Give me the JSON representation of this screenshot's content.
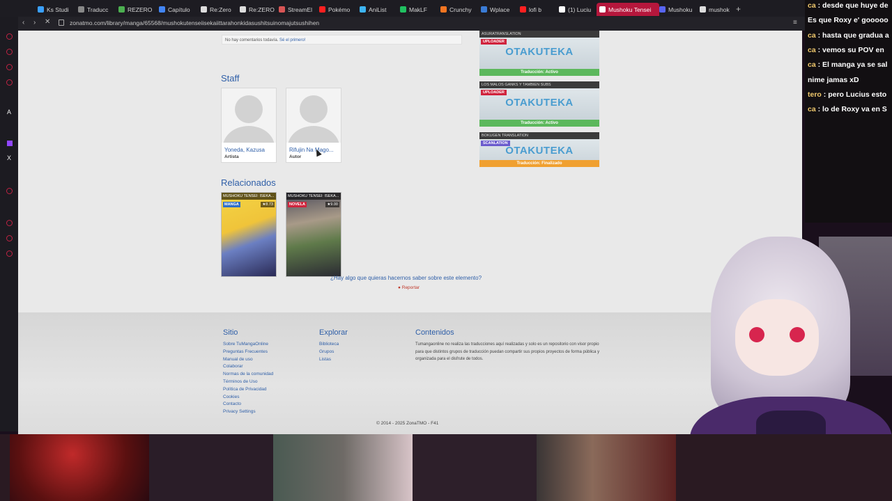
{
  "browser": {
    "tabs": [
      {
        "label": "Ks Studi",
        "color": "#3aa0ff"
      },
      {
        "label": "Traducc",
        "color": "#888888"
      },
      {
        "label": "REZERO",
        "color": "#4caf50"
      },
      {
        "label": "Capítulo",
        "color": "#4285f4"
      },
      {
        "label": "Re:Zero",
        "color": "#dddddd"
      },
      {
        "label": "Re:ZERO",
        "color": "#dddddd"
      },
      {
        "label": "StreamEl",
        "color": "#d85555"
      },
      {
        "label": "Pokémo",
        "color": "#ff2020"
      },
      {
        "label": "AniList",
        "color": "#3db4f2"
      },
      {
        "label": "MakLF",
        "color": "#20c060"
      },
      {
        "label": "Crunchy",
        "color": "#f47521"
      },
      {
        "label": "Wplace",
        "color": "#3a7bd5"
      },
      {
        "label": "lofi b",
        "color": "#ff2020"
      },
      {
        "label": "(1) Luciu",
        "color": "#ffffff"
      },
      {
        "label": "Mushoku Tensei",
        "color": "#ffffff"
      },
      {
        "label": "Mushoku",
        "color": "#5865f2"
      },
      {
        "label": "mushok",
        "color": "#dddddd"
      }
    ],
    "url": "zonatmo.com/library/manga/65568/mushokutenseiisekaiittarahonkidasushitsuinomajutsushihen"
  },
  "page": {
    "comments_empty": "No hay comentarios todavía.",
    "comments_first_link": "Sé el primero!",
    "staff_heading": "Staff",
    "staff": [
      {
        "name": "Yoneda, Kazusa",
        "role": "Artista"
      },
      {
        "name": "Rifujin Na Mago...",
        "role": "Autor"
      }
    ],
    "related_heading": "Relacionados",
    "related": [
      {
        "title": "MUSHOKU TENSEI: ISEKA...",
        "type": "MANGA",
        "type_color": "#2f6fc8",
        "score": "8.73"
      },
      {
        "title": "MUSHOKU TENSEI: ISEKA...",
        "type": "NOVELA",
        "type_color": "#d0243d",
        "score": "9.00"
      }
    ],
    "report_question": "¿Hay algo que quieras hacernos saber sobre este elemento?",
    "report_link": "Reportar",
    "groups": [
      {
        "name": "ASURATRANSLATION",
        "badge": "UPLOADER",
        "badge_color": "#d0243d",
        "logo": "OTAKUTEKA",
        "status": "Traducción: Activo",
        "status_color": "#5cb85c"
      },
      {
        "name": "LOS MALOS GANKS Y TAMBIEN SUBS",
        "badge": "UPLOADER",
        "badge_color": "#d0243d",
        "logo": "OTAKUTEKA",
        "status": "Traducción: Activo",
        "status_color": "#5cb85c"
      },
      {
        "name": "BOKUGEN TRANSLATION",
        "badge": "SCANLATION",
        "badge_color": "#6a5acd",
        "logo": "OTAKUTEKA",
        "status": "Traducción: Finalizado",
        "status_color": "#f0a030"
      }
    ],
    "footer": {
      "sitio_heading": "Sitio",
      "sitio_links": [
        "Sobre TuMangaOnline",
        "Preguntas Frecuentes",
        "Manual de uso",
        "Colaborar",
        "Normas de la comunidad",
        "Términos de Uso",
        "Política de Privacidad",
        "Cookies",
        "Contacto",
        "Privacy Settings"
      ],
      "explorar_heading": "Explorar",
      "explorar_links": [
        "Biblioteca",
        "Grupos",
        "Listas"
      ],
      "contenidos_heading": "Contenidos",
      "contenidos_text": "Tumangaonline no realiza las traducciones aquí realizadas y solo es un repositorio con visor propio para que distintos grupos de traducción puedan compartir sus propios proyectos de forma pública y organizada para el disfrute de todos.",
      "copyright": "© 2014 - 2025 ZonaTMO - F41"
    }
  },
  "chat": [
    {
      "user": "ca",
      "msg": "desde que huye de"
    },
    {
      "user": "",
      "msg": "Es que Roxy e' gooooo"
    },
    {
      "user": "ca",
      "msg": "hasta que gradua a"
    },
    {
      "user": "ca",
      "msg": "vemos su POV en"
    },
    {
      "user": "ca",
      "msg": "El manga ya se sal"
    },
    {
      "user": "",
      "msg": "nime jamas xD"
    },
    {
      "user": "tero",
      "msg": "pero Lucius esto"
    },
    {
      "user": "ca",
      "msg": "lo de Roxy va en S"
    }
  ]
}
